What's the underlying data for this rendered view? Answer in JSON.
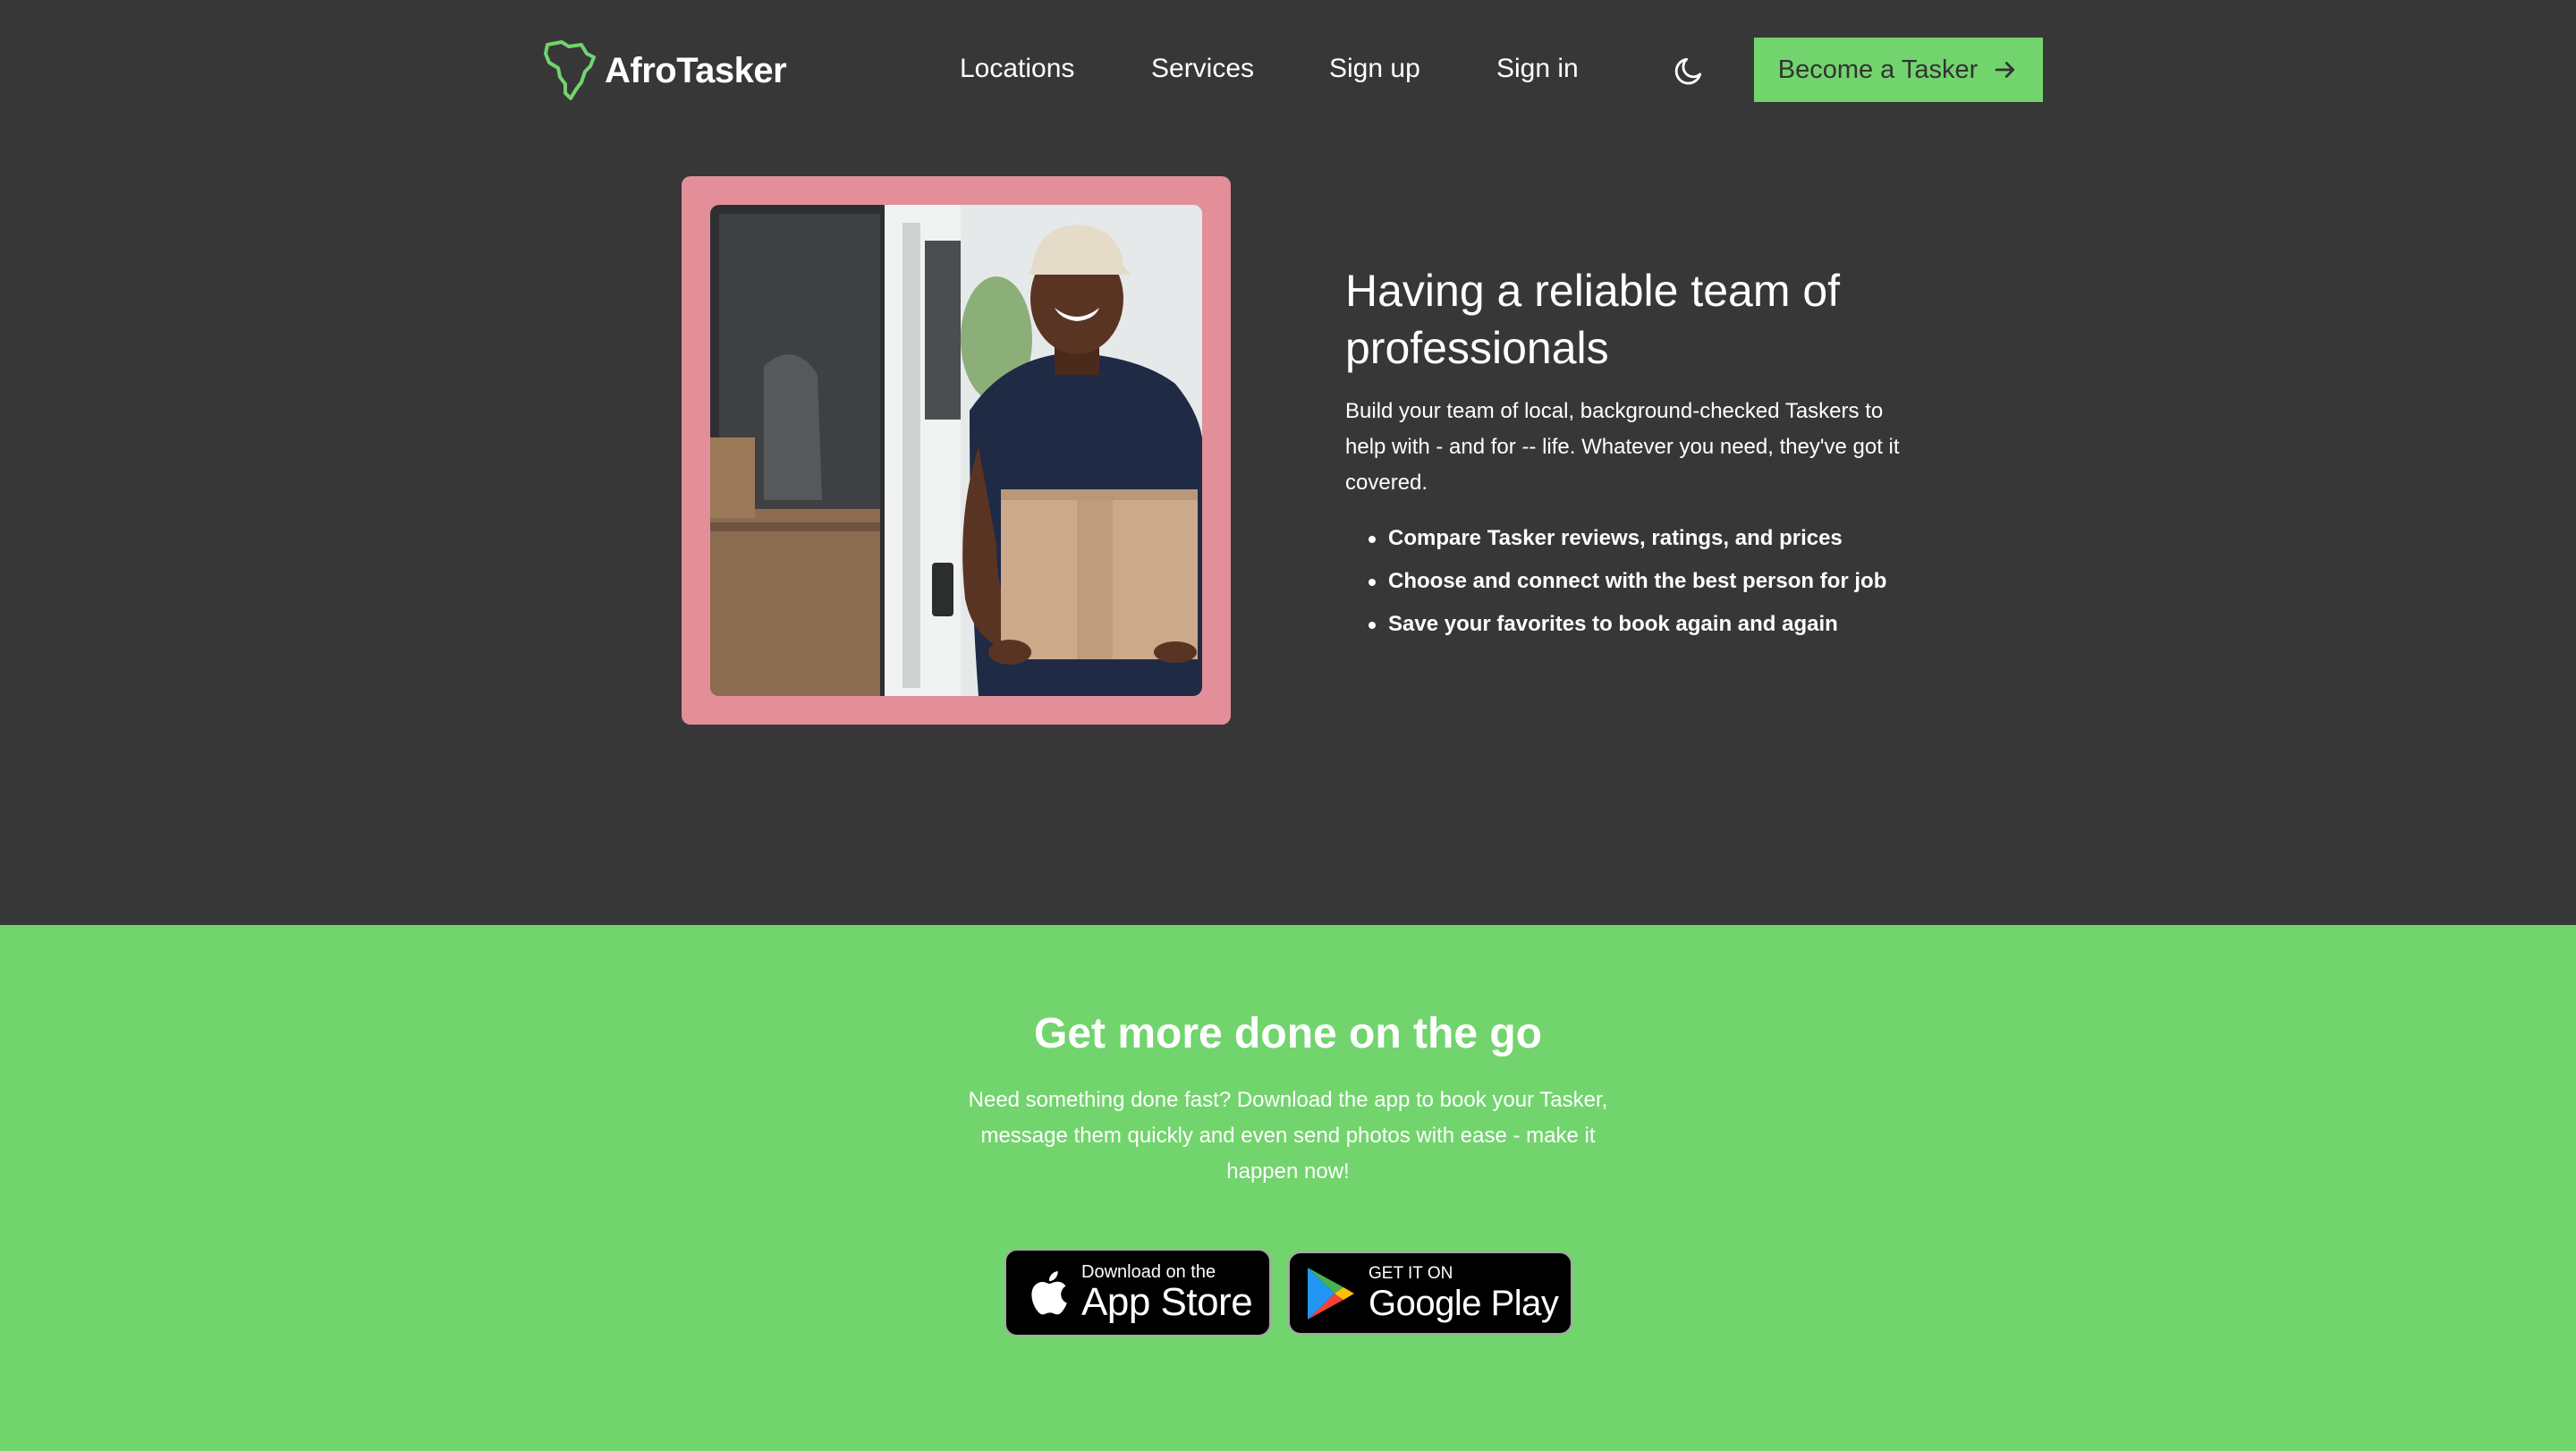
{
  "brand": {
    "name": "AfroTasker",
    "accent": "#72d46d"
  },
  "nav": {
    "links": [
      "Locations",
      "Services",
      "Sign up",
      "Sign in"
    ],
    "theme_toggle_icon": "moon-icon",
    "cta_label": "Become a Tasker",
    "cta_icon": "arrow-right-icon"
  },
  "feature": {
    "image": "delivery-man-holding-box",
    "frame_color": "#e28f9a",
    "heading": "Having a reliable team of professionals",
    "description": "Build your team of local, background-checked Taskers to help with - and for -- life. Whatever you need, they've got it covered.",
    "bullets": [
      "Compare Tasker reviews, ratings, and prices",
      "Choose and connect with the best person for job",
      "Save your favorites to book again and again"
    ]
  },
  "app_section": {
    "background": "#72d46d",
    "title": "Get more done on the go",
    "description": "Need something done fast? Download the app to book your Tasker, message them quickly and even send photos with ease - make it happen now!",
    "app_store": {
      "small": "Download on the",
      "big": "App Store"
    },
    "google_play": {
      "small": "GET IT ON",
      "big": "Google Play"
    }
  }
}
